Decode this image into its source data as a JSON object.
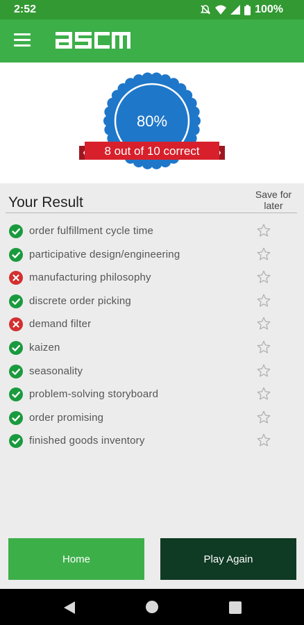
{
  "status_bar": {
    "time": "2:52",
    "battery": "100%",
    "icons": [
      "dnd-off-icon",
      "wifi-icon",
      "signal-icon",
      "battery-icon"
    ]
  },
  "app_bar": {
    "logo_text": "ascm",
    "menu_icon": "hamburger-menu-icon"
  },
  "score": {
    "percent": "80%",
    "summary": "8 out of 10 correct"
  },
  "results": {
    "title": "Your Result",
    "save_header": "Save for later",
    "items": [
      {
        "label": "order fulfillment cycle time",
        "correct": true
      },
      {
        "label": "participative design/engineering",
        "correct": true
      },
      {
        "label": "manufacturing philosophy",
        "correct": false
      },
      {
        "label": "discrete order picking",
        "correct": true
      },
      {
        "label": "demand filter",
        "correct": false
      },
      {
        "label": "kaizen",
        "correct": true
      },
      {
        "label": "seasonality",
        "correct": true
      },
      {
        "label": "problem-solving storyboard",
        "correct": true
      },
      {
        "label": "order promising",
        "correct": true
      },
      {
        "label": "finished goods inventory",
        "correct": true
      }
    ]
  },
  "buttons": {
    "home": "Home",
    "play_again": "Play Again"
  },
  "colors": {
    "brand_green": "#3daf49",
    "dark_green": "#0f3a23",
    "badge_blue": "#1f77c9",
    "ribbon_red": "#d7202b",
    "correct": "#1a9a3e",
    "incorrect": "#d32f2f"
  }
}
